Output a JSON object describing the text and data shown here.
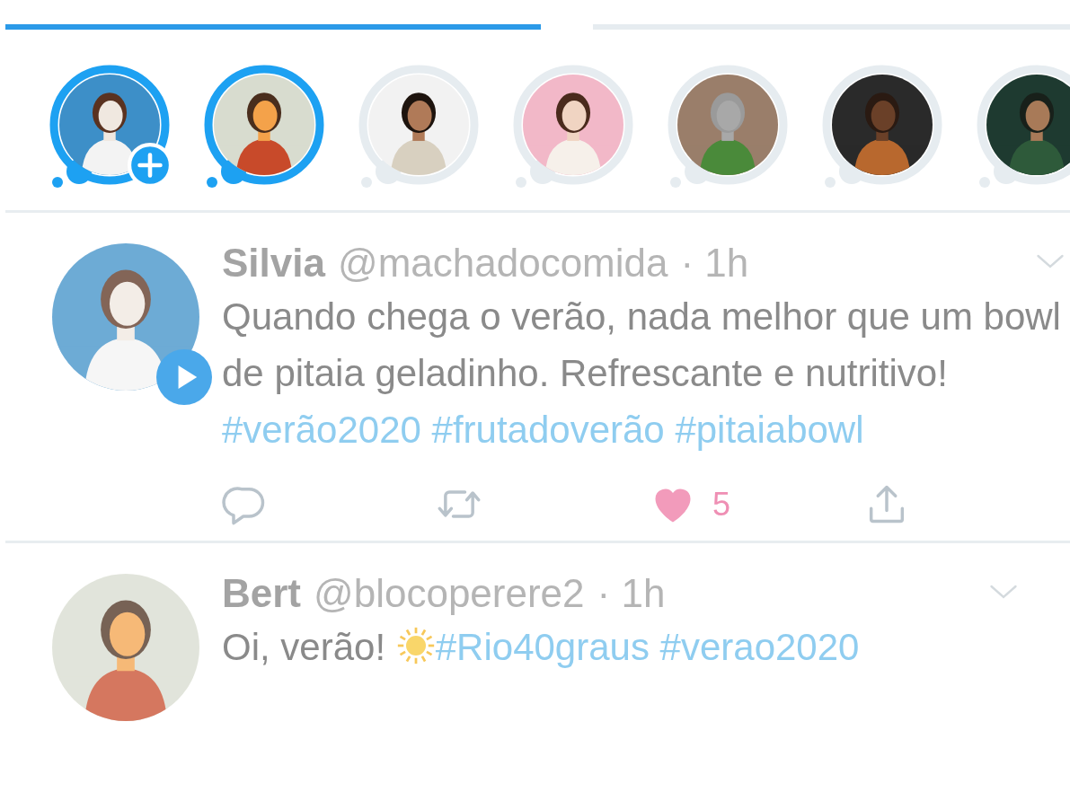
{
  "tabs": [
    {
      "selected": true
    },
    {
      "selected": false
    }
  ],
  "fleets": [
    {
      "kind": "own",
      "unread": true
    },
    {
      "kind": "user",
      "unread": true
    },
    {
      "kind": "user",
      "unread": false
    },
    {
      "kind": "user",
      "unread": false
    },
    {
      "kind": "user",
      "unread": false
    },
    {
      "kind": "user",
      "unread": false
    },
    {
      "kind": "user",
      "unread": false
    }
  ],
  "tweets": [
    {
      "name": "Silvia",
      "handle": "@machadocomida",
      "time": "· 1h",
      "has_video": true,
      "text": [
        {
          "kind": "plain",
          "text": "Quando chega o verão, nada melhor que um bowl de pitaia geladinho. Refrescante e nutritivo!"
        },
        {
          "kind": "hashtag",
          "text": "#verão2020"
        },
        {
          "kind": "hashtag",
          "text": "#frutadoverão"
        },
        {
          "kind": "hashtag",
          "text": "#pitaiabowl"
        }
      ],
      "actions": [
        {
          "kind": "reply"
        },
        {
          "kind": "retweet"
        },
        {
          "kind": "like",
          "liked": true,
          "count": "5"
        },
        {
          "kind": "share"
        }
      ]
    },
    {
      "name": "Bert",
      "handle": "@blocoperere2",
      "time": "· 1h",
      "has_video": false,
      "text": [
        {
          "kind": "plain",
          "text": "Oi, verão!"
        },
        {
          "kind": "sun"
        },
        {
          "kind": "hashtag",
          "text": "#Rio40graus"
        },
        {
          "kind": "hashtag",
          "text": "#verao2020"
        }
      ]
    }
  ]
}
